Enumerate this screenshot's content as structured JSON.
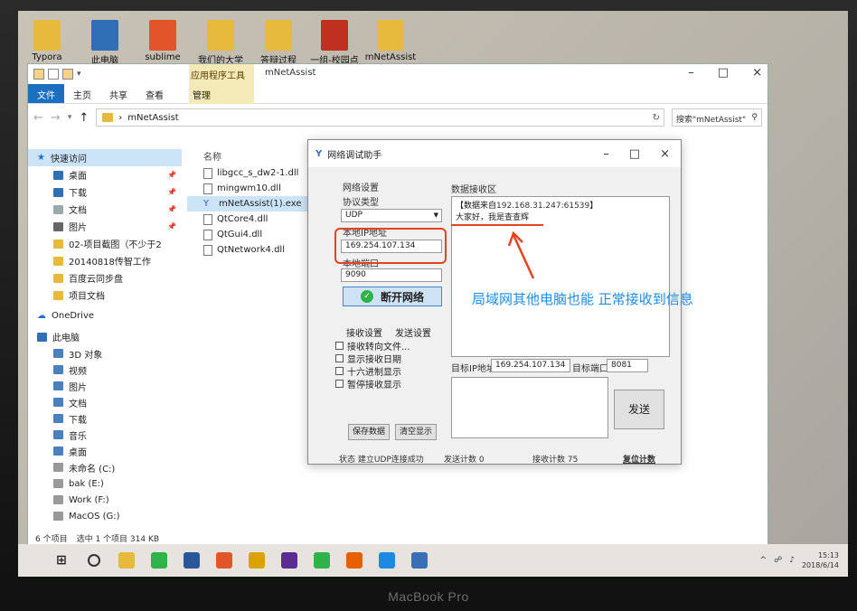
{
  "desktop": {
    "icons": [
      {
        "label": "Typora",
        "color": "#e7b93d"
      },
      {
        "label": "此电脑",
        "color": "#2e6fb5"
      },
      {
        "label": "sublime",
        "color": "#e2542a"
      },
      {
        "label": "我们的大学",
        "color": "#e7b93d"
      },
      {
        "label": "答辩过程",
        "color": "#e7b93d"
      },
      {
        "label": "一组-校园点",
        "color": "#c03020"
      },
      {
        "label": "mNetAssist",
        "color": "#e7b93d"
      }
    ]
  },
  "explorer": {
    "context_tool": "应用程序工具",
    "window_title": "mNetAssist",
    "ribbon_tabs": [
      "文件",
      "主页",
      "共享",
      "查看",
      "管理"
    ],
    "address": "mNetAssist",
    "search_placeholder": "搜索\"mNetAssist\"",
    "nav": {
      "quick_access": "快速访问",
      "pinned": [
        "桌面",
        "下载",
        "文档",
        "图片"
      ],
      "folders": [
        "02-项目截图（不少于2",
        "20140818传智工作",
        "百度云同步盘",
        "项目文档"
      ],
      "onedrive": "OneDrive",
      "this_pc": "此电脑",
      "pc_items": [
        "3D 对象",
        "视频",
        "图片",
        "文档",
        "下载",
        "音乐",
        "桌面",
        "未命名 (C:)",
        "bak (E:)",
        "Work (F:)",
        "MacOS (G:)"
      ]
    },
    "column_name": "名称",
    "files": [
      "libgcc_s_dw2-1.dll",
      "mingwm10.dll",
      "mNetAssist(1).exe",
      "QtCore4.dll",
      "QtGui4.dll",
      "QtNetwork4.dll"
    ],
    "status": {
      "count": "6 个项目",
      "selected": "选中 1 个项目 314 KB"
    }
  },
  "netassist": {
    "title": "网络调试助手",
    "net_settings": "网络设置",
    "protocol_label": "协议类型",
    "protocol_value": "UDP",
    "local_ip_label": "本地IP地址",
    "local_ip": "169.254.107.134",
    "local_port_label": "本地端口",
    "local_port": "9090",
    "connect_btn": "断开网络",
    "recv_tab": "接收设置",
    "send_tab": "发送设置",
    "recv_options": [
      "接收转向文件...",
      "显示接收日期",
      "十六进制显示",
      "暂停接收显示"
    ],
    "save_btn": "保存数据",
    "clear_btn": "清空显示",
    "recv_area_label": "数据接收区",
    "recv_header_prefix": "【数据来自",
    "recv_source": "192.168.31.247:61539",
    "recv_header_suffix": "】",
    "recv_message": "大家好，我是查查辉",
    "target_ip_label": "目标IP地址",
    "target_ip": "169.254.107.134",
    "target_port_label": "目标端口",
    "target_port": "8081",
    "send_btn": "发送",
    "status_text": "状态 建立UDP连接成功",
    "send_count": "发送计数 0",
    "recv_count": "接收计数 75",
    "reset_count": "复位计数"
  },
  "annotation": "局域网其他电脑也能 正常接收到信息",
  "taskbar": {
    "apps": [
      {
        "name": "start",
        "color": "#333333"
      },
      {
        "name": "cortana",
        "color": "#333333"
      },
      {
        "name": "explorer",
        "color": "#e7b93d"
      },
      {
        "name": "wechat-work",
        "color": "#2fb24a"
      },
      {
        "name": "word",
        "color": "#2b579a"
      },
      {
        "name": "sublime",
        "color": "#e2542a"
      },
      {
        "name": "chrome",
        "color": "#d9a400"
      },
      {
        "name": "vs",
        "color": "#5c2d91"
      },
      {
        "name": "wechat",
        "color": "#2fb24a"
      },
      {
        "name": "firefox",
        "color": "#e66000"
      },
      {
        "name": "app",
        "color": "#1e88e5"
      },
      {
        "name": "netassist",
        "color": "#3a6fb5"
      }
    ],
    "time": "15:13",
    "date": "2018/6/14"
  },
  "device_label": "MacBook Pro"
}
